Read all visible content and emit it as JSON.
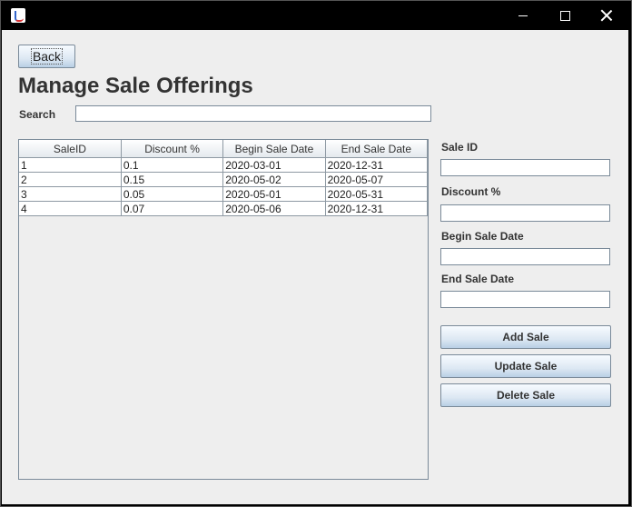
{
  "window": {
    "minimize_symbol": "—",
    "maximize_symbol": "☐",
    "close_symbol": "✕"
  },
  "toolbar": {
    "back_label": "Back"
  },
  "page_title": "Manage Sale Offerings",
  "search": {
    "label": "Search",
    "value": ""
  },
  "table": {
    "columns": [
      "SaleID",
      "Discount %",
      "Begin Sale Date",
      "End Sale Date"
    ],
    "rows": [
      [
        "1",
        "0.1",
        "2020-03-01",
        "2020-12-31"
      ],
      [
        "2",
        "0.15",
        "2020-05-02",
        "2020-05-07"
      ],
      [
        "3",
        "0.05",
        "2020-05-01",
        "2020-05-31"
      ],
      [
        "4",
        "0.07",
        "2020-05-06",
        "2020-12-31"
      ]
    ]
  },
  "form": {
    "sale_id_label": "Sale ID",
    "discount_label": "Discount %",
    "begin_label": "Begin Sale Date",
    "end_label": "End Sale Date",
    "sale_id_value": "",
    "discount_value": "",
    "begin_value": "",
    "end_value": ""
  },
  "actions": {
    "add_label": "Add Sale",
    "update_label": "Update Sale",
    "delete_label": "Delete Sale"
  }
}
